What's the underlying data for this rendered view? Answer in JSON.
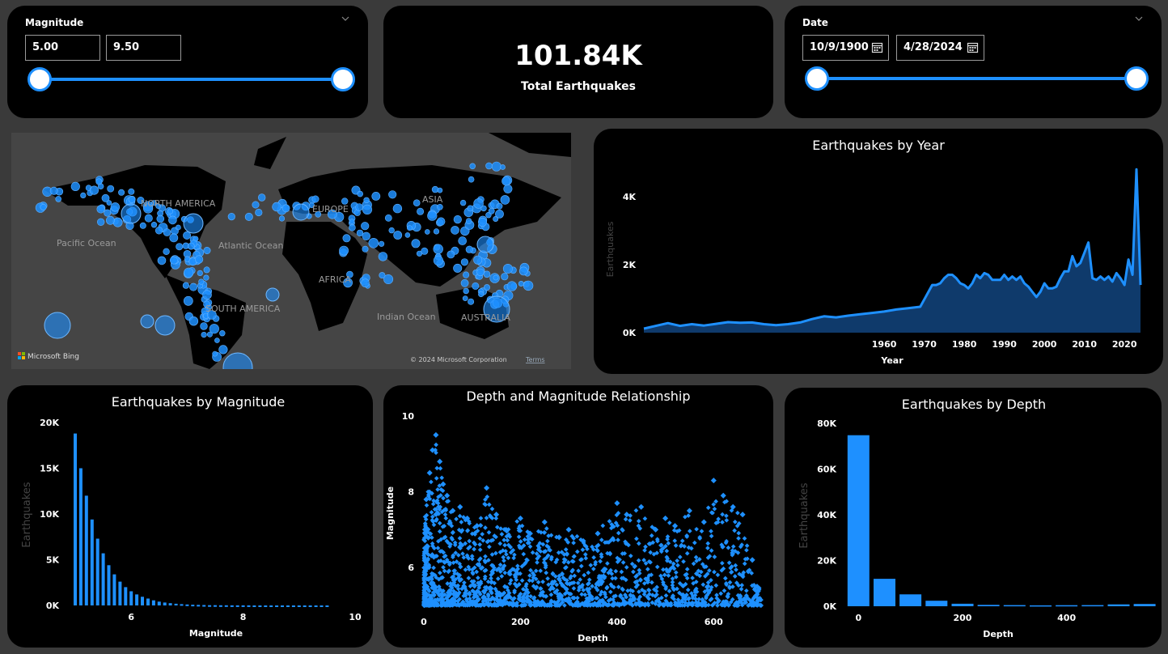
{
  "magnitude_slicer": {
    "title": "Magnitude",
    "min_value": "5.00",
    "max_value": "9.50"
  },
  "kpi": {
    "value": "101.84K",
    "label": "Total Earthquakes"
  },
  "date_slicer": {
    "title": "Date",
    "start_value": "10/9/1900",
    "end_value": "4/28/2024"
  },
  "map": {
    "labels": [
      "NORTH AMERICA",
      "EUROPE",
      "ASIA",
      "Pacific Ocean",
      "Atlantic Ocean",
      "AFRICA",
      "SOUTH AMERICA",
      "Indian Ocean",
      "AUSTRALIA"
    ],
    "bing_label": "Microsoft Bing",
    "copyright": "© 2024 Microsoft Corporation",
    "terms": "Terms",
    "colors": {
      "land": "#000000",
      "water": "#454545",
      "marker": "#1e90ff"
    }
  },
  "accent_color": "#1e90ff",
  "chart_data": [
    {
      "type": "area",
      "title": "Earthquakes by Year",
      "xlabel": "Year",
      "ylabel": "Earthquakes",
      "xlim": [
        1900,
        2024
      ],
      "ylim": [
        0,
        4900
      ],
      "yticks": [
        0,
        2000,
        4000
      ],
      "ytick_labels": [
        "0K",
        "2K",
        "4K"
      ],
      "xticks": [
        1960,
        1970,
        1980,
        1990,
        2000,
        2010,
        2020
      ],
      "x": [
        1900,
        1903,
        1906,
        1909,
        1912,
        1915,
        1918,
        1921,
        1924,
        1927,
        1930,
        1933,
        1936,
        1939,
        1942,
        1945,
        1948,
        1951,
        1954,
        1957,
        1960,
        1963,
        1966,
        1969,
        1972,
        1973,
        1974,
        1975,
        1976,
        1977,
        1978,
        1979,
        1980,
        1981,
        1982,
        1983,
        1984,
        1985,
        1986,
        1987,
        1988,
        1989,
        1990,
        1991,
        1992,
        1993,
        1994,
        1995,
        1996,
        1997,
        1998,
        1999,
        2000,
        2001,
        2002,
        2003,
        2004,
        2005,
        2006,
        2007,
        2008,
        2009,
        2010,
        2011,
        2012,
        2013,
        2014,
        2015,
        2016,
        2017,
        2018,
        2019,
        2020,
        2021,
        2022,
        2023,
        2024
      ],
      "values": [
        120,
        200,
        280,
        200,
        250,
        210,
        260,
        310,
        290,
        300,
        250,
        220,
        250,
        300,
        400,
        480,
        450,
        500,
        540,
        580,
        620,
        680,
        720,
        760,
        1400,
        1400,
        1450,
        1600,
        1700,
        1700,
        1600,
        1450,
        1400,
        1300,
        1450,
        1700,
        1600,
        1750,
        1700,
        1550,
        1550,
        1550,
        1700,
        1550,
        1650,
        1550,
        1650,
        1450,
        1350,
        1200,
        1050,
        1200,
        1450,
        1300,
        1300,
        1350,
        1600,
        1800,
        1800,
        2250,
        1950,
        2050,
        2350,
        2650,
        1600,
        1550,
        1650,
        1550,
        1650,
        1500,
        1750,
        1600,
        1400,
        2150,
        1700,
        4800,
        1400
      ]
    },
    {
      "type": "bar",
      "title": "Earthquakes by Magnitude",
      "xlabel": "Magnitude",
      "ylabel": "Earthquakes",
      "xlim": [
        5,
        10
      ],
      "ylim": [
        0,
        20000
      ],
      "yticks": [
        0,
        5000,
        10000,
        15000,
        20000
      ],
      "ytick_labels": [
        "0K",
        "5K",
        "10K",
        "15K",
        "20K"
      ],
      "xticks": [
        6,
        8,
        10
      ],
      "x": [
        5.0,
        5.1,
        5.2,
        5.3,
        5.4,
        5.5,
        5.6,
        5.7,
        5.8,
        5.9,
        6.0,
        6.1,
        6.2,
        6.3,
        6.4,
        6.5,
        6.6,
        6.7,
        6.8,
        6.9,
        7.0,
        7.1,
        7.2,
        7.3,
        7.4,
        7.5,
        7.6,
        7.7,
        7.8,
        7.9,
        8.0,
        8.1,
        8.2,
        8.3,
        8.4,
        8.5,
        8.6,
        8.7,
        8.8,
        8.9,
        9.0,
        9.1,
        9.2,
        9.3,
        9.4,
        9.5
      ],
      "values": [
        18800,
        15000,
        12000,
        9400,
        7300,
        5700,
        4400,
        3400,
        2600,
        2000,
        1550,
        1200,
        950,
        750,
        560,
        420,
        320,
        250,
        190,
        140,
        110,
        80,
        60,
        45,
        30,
        25,
        20,
        15,
        10,
        8,
        6,
        5,
        4,
        3,
        2,
        2,
        1,
        1,
        1,
        1,
        1,
        1,
        1,
        1,
        1,
        1
      ]
    },
    {
      "type": "scatter",
      "title": "Depth and Magnitude Relationship",
      "xlabel": "Depth",
      "ylabel": "Magnitude",
      "xlim": [
        0,
        700
      ],
      "ylim": [
        5,
        10
      ],
      "xticks": [
        0,
        200,
        400,
        600
      ],
      "yticks": [
        6,
        8,
        10
      ],
      "x": [
        5,
        12,
        18,
        25,
        33,
        40,
        48,
        60,
        75,
        90,
        110,
        130,
        150,
        170,
        200,
        220,
        250,
        280,
        300,
        330,
        360,
        400,
        420,
        450,
        480,
        500,
        520,
        550,
        580,
        600,
        620,
        640,
        660,
        680,
        690
      ],
      "values": [
        7.8,
        8.5,
        9.1,
        9.5,
        8.8,
        8.2,
        7.9,
        7.5,
        7.6,
        7.3,
        7.1,
        8.1,
        7.4,
        7.0,
        7.3,
        6.9,
        7.2,
        6.8,
        7.0,
        6.7,
        6.9,
        7.7,
        7.4,
        7.6,
        7.0,
        7.3,
        7.1,
        7.5,
        7.2,
        8.3,
        7.9,
        7.6,
        7.4,
        6.2,
        5.5
      ],
      "series_color": "#1e90ff"
    },
    {
      "type": "bar",
      "title": "Earthquakes by Depth",
      "xlabel": "Depth",
      "ylabel": "Earthquakes",
      "xlim": [
        -30,
        570
      ],
      "ylim": [
        0,
        80000
      ],
      "yticks": [
        0,
        20000,
        40000,
        60000,
        80000
      ],
      "ytick_labels": [
        "0K",
        "20K",
        "40K",
        "60K",
        "80K"
      ],
      "xticks": [
        0,
        200,
        400
      ],
      "x": [
        0,
        50,
        100,
        150,
        200,
        250,
        300,
        350,
        400,
        450,
        500,
        550
      ],
      "values": [
        74800,
        12000,
        5200,
        2400,
        1100,
        600,
        500,
        400,
        450,
        500,
        800,
        1000
      ]
    }
  ]
}
